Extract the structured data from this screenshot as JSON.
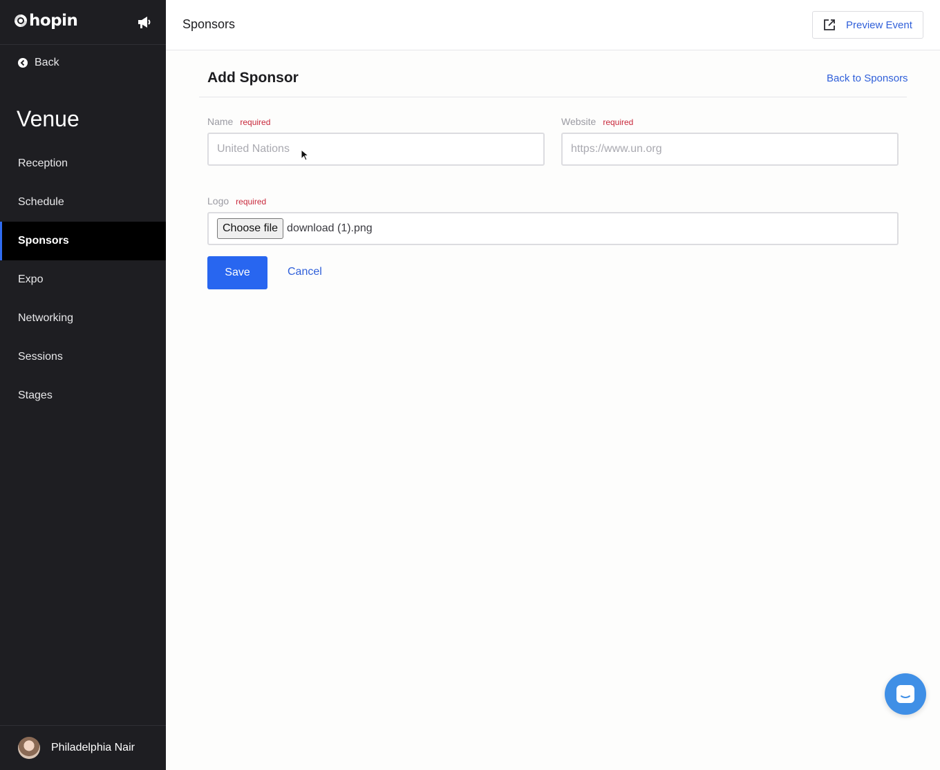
{
  "app": {
    "logo_text": "hopin"
  },
  "sidebar": {
    "back_label": "Back",
    "section_title": "Venue",
    "items": [
      {
        "label": "Reception",
        "active": false
      },
      {
        "label": "Schedule",
        "active": false
      },
      {
        "label": "Sponsors",
        "active": true
      },
      {
        "label": "Expo",
        "active": false
      },
      {
        "label": "Networking",
        "active": false
      },
      {
        "label": "Sessions",
        "active": false
      },
      {
        "label": "Stages",
        "active": false
      }
    ],
    "user_name": "Philadelphia Nair"
  },
  "header": {
    "title": "Sponsors",
    "preview_label": "Preview Event"
  },
  "form": {
    "title": "Add Sponsor",
    "back_link": "Back to Sponsors",
    "name": {
      "label": "Name",
      "required": "required",
      "value": "",
      "placeholder": "United Nations"
    },
    "website": {
      "label": "Website",
      "required": "required",
      "value": "",
      "placeholder": "https://www.un.org"
    },
    "logo": {
      "label": "Logo",
      "required": "required",
      "button_label": "Choose file",
      "file_name": "download (1).png"
    },
    "save_label": "Save",
    "cancel_label": "Cancel"
  },
  "colors": {
    "accent": "#2866f0",
    "link": "#2f5fd9",
    "sidebar_bg": "#1e1e22",
    "required": "#c8283b"
  },
  "icons": [
    "hopin-logo-icon",
    "megaphone-icon",
    "back-arrow-icon",
    "external-link-icon",
    "chat-icon",
    "mouse-cursor-icon"
  ]
}
